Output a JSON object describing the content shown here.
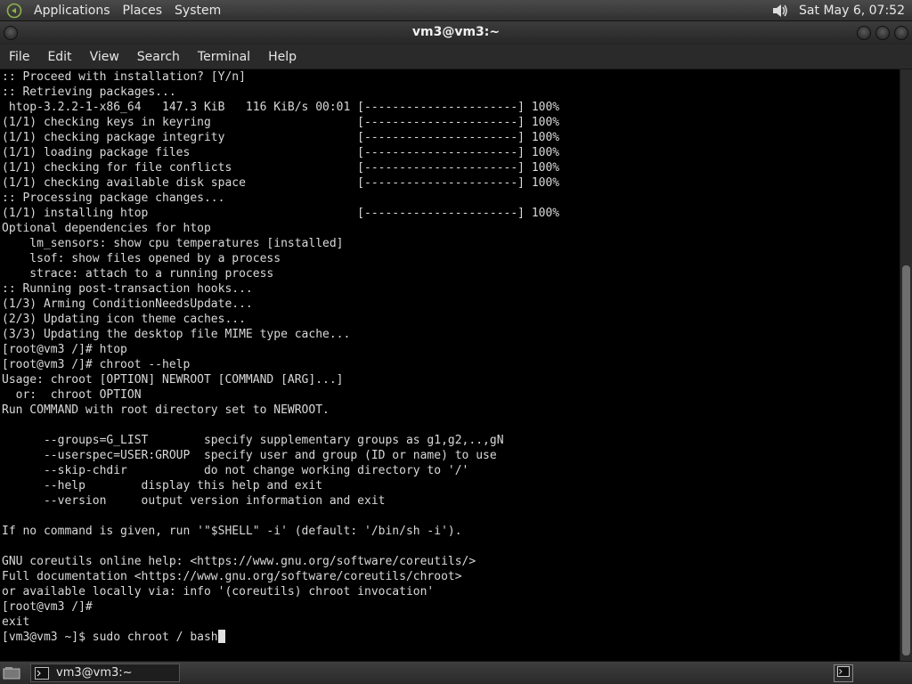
{
  "top_panel": {
    "menus": [
      "Applications",
      "Places",
      "System"
    ],
    "clock": "Sat May  6, 07:52",
    "volume_icon": "speaker-icon"
  },
  "window": {
    "title": "vm3@vm3:~"
  },
  "menubar": {
    "items": [
      "File",
      "Edit",
      "View",
      "Search",
      "Terminal",
      "Help"
    ]
  },
  "terminal": {
    "lines": [
      ":: Proceed with installation? [Y/n]",
      ":: Retrieving packages...",
      " htop-3.2.2-1-x86_64   147.3 KiB   116 KiB/s 00:01 [----------------------] 100%",
      "(1/1) checking keys in keyring                     [----------------------] 100%",
      "(1/1) checking package integrity                   [----------------------] 100%",
      "(1/1) loading package files                        [----------------------] 100%",
      "(1/1) checking for file conflicts                  [----------------------] 100%",
      "(1/1) checking available disk space                [----------------------] 100%",
      ":: Processing package changes...",
      "(1/1) installing htop                              [----------------------] 100%",
      "Optional dependencies for htop",
      "    lm_sensors: show cpu temperatures [installed]",
      "    lsof: show files opened by a process",
      "    strace: attach to a running process",
      ":: Running post-transaction hooks...",
      "(1/3) Arming ConditionNeedsUpdate...",
      "(2/3) Updating icon theme caches...",
      "(3/3) Updating the desktop file MIME type cache...",
      "[root@vm3 /]# htop",
      "[root@vm3 /]# chroot --help",
      "Usage: chroot [OPTION] NEWROOT [COMMAND [ARG]...]",
      "  or:  chroot OPTION",
      "Run COMMAND with root directory set to NEWROOT.",
      "",
      "      --groups=G_LIST        specify supplementary groups as g1,g2,..,gN",
      "      --userspec=USER:GROUP  specify user and group (ID or name) to use",
      "      --skip-chdir           do not change working directory to '/'",
      "      --help        display this help and exit",
      "      --version     output version information and exit",
      "",
      "If no command is given, run '\"$SHELL\" -i' (default: '/bin/sh -i').",
      "",
      "GNU coreutils online help: <https://www.gnu.org/software/coreutils/>",
      "Full documentation <https://www.gnu.org/software/coreutils/chroot>",
      "or available locally via: info '(coreutils) chroot invocation'",
      "[root@vm3 /]#",
      "exit"
    ],
    "prompt_line": "[vm3@vm3 ~]$ sudo chroot / bash"
  },
  "bottom_panel": {
    "task_label": "vm3@vm3:~"
  }
}
